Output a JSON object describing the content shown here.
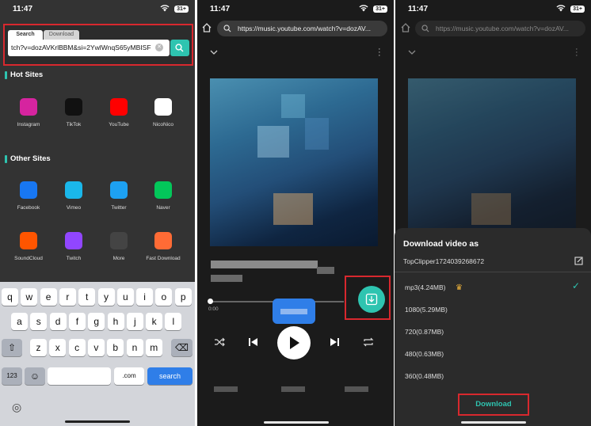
{
  "status": {
    "time": "11:47",
    "battery": "31+"
  },
  "panel1": {
    "tabs": [
      "Search",
      "Download"
    ],
    "url_value": "tch?v=dozAVKrlBBM&si=2YwlWnqS65yMBISF",
    "hot_sites_title": "Hot Sites",
    "hot_sites": [
      {
        "label": "Instagram",
        "color": "#d6249f",
        "icon": "instagram-icon"
      },
      {
        "label": "TikTok",
        "color": "#111111",
        "icon": "tiktok-icon"
      },
      {
        "label": "YouTube",
        "color": "#ff0000",
        "icon": "youtube-icon"
      },
      {
        "label": "NicoNico",
        "color": "#ffffff",
        "icon": "niconico-icon"
      }
    ],
    "other_sites_title": "Other Sites",
    "other_sites": [
      {
        "label": "Facebook",
        "color": "#1877f2",
        "icon": "facebook-icon"
      },
      {
        "label": "Vimeo",
        "color": "#1ab7ea",
        "icon": "vimeo-icon"
      },
      {
        "label": "Twitter",
        "color": "#1da1f2",
        "icon": "twitter-icon"
      },
      {
        "label": "Naver",
        "color": "#03c75a",
        "icon": "naver-icon"
      },
      {
        "label": "SoundCloud",
        "color": "#ff5500",
        "icon": "soundcloud-icon"
      },
      {
        "label": "Twitch",
        "color": "#9146ff",
        "icon": "twitch-icon"
      },
      {
        "label": "More",
        "color": "#444444",
        "icon": "more-icon"
      },
      {
        "label": "Fast Download",
        "color": "#ff6b35",
        "icon": "rocket-icon"
      }
    ],
    "keyboard": {
      "row1": [
        "q",
        "w",
        "e",
        "r",
        "t",
        "y",
        "u",
        "i",
        "o",
        "p"
      ],
      "row2": [
        "a",
        "s",
        "d",
        "f",
        "g",
        "h",
        "j",
        "k",
        "l"
      ],
      "row3": [
        "z",
        "x",
        "c",
        "v",
        "b",
        "n",
        "m"
      ],
      "num_key": "123",
      "com_key": ".com",
      "search_key": "search"
    }
  },
  "panel2": {
    "url": "https://music.youtube.com/watch?v=dozAV...",
    "time_elapsed": "0:00"
  },
  "panel3": {
    "url": "https://music.youtube.com/watch?v=dozAV...",
    "sheet_title": "Download video as",
    "file_name": "TopClipper1724039268672",
    "options": [
      "mp3(4.24MB)",
      "1080(5.29MB)",
      "720(0.87MB)",
      "480(0.63MB)",
      "360(0.48MB)"
    ],
    "selected_option": 0,
    "download_label": "Download",
    "accent": "#2ec4b0",
    "highlight": "#d8282e"
  }
}
